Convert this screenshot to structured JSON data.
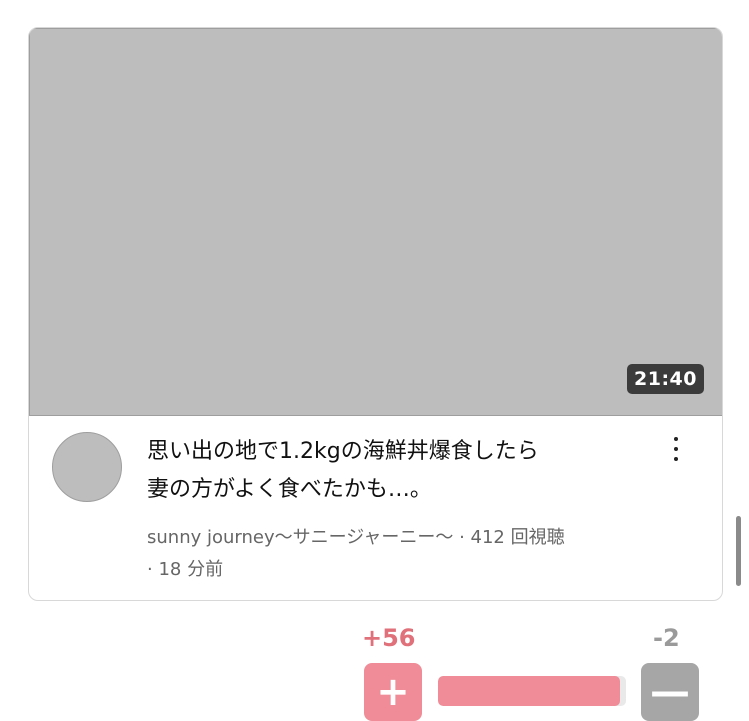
{
  "video": {
    "duration": "21:40",
    "title_line1": "思い出の地で1.2kgの海鮮丼爆食したら",
    "title_line2": "妻の方がよく食べたかも…。",
    "meta_line1": "sunny journey〜サニージャーニー〜 · 412 回視聴",
    "meta_line2": "· 18 分前"
  },
  "vote": {
    "plus_count": "+56",
    "minus_count": "-2",
    "plus_glyph": "+",
    "minus_glyph": "—",
    "ratio": 0.966
  },
  "colors": {
    "plus": "#f08c97",
    "minus": "#a6a6a6"
  }
}
